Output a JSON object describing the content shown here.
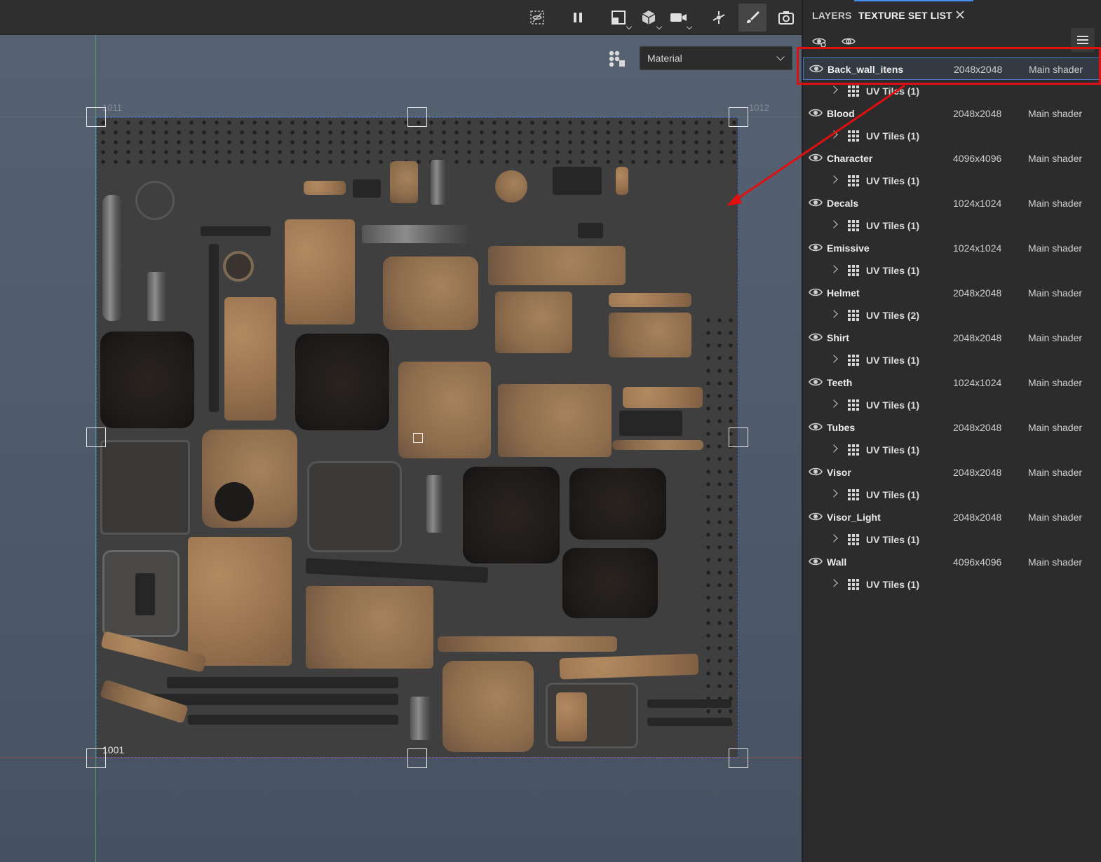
{
  "toolbar": {
    "buttons": [
      {
        "name": "hide-icon"
      },
      {
        "name": "pause-icon"
      },
      {
        "name": "split-view-icon"
      },
      {
        "name": "cube-icon"
      },
      {
        "name": "camera-video-icon"
      },
      {
        "name": "effects-icon"
      },
      {
        "name": "paint-brush-icon"
      },
      {
        "name": "screenshot-camera-icon"
      }
    ]
  },
  "viewport": {
    "display_mode": "Material",
    "udim_labels": {
      "top_left": "1011",
      "top_right": "1012",
      "bottom_left": "1001"
    }
  },
  "panel": {
    "tabs": [
      "LAYERS",
      "TEXTURE SET LIST"
    ],
    "active_tab": "TEXTURE SET LIST",
    "texture_sets": [
      {
        "name": "Back_wall_itens",
        "size": "2048x2048",
        "shader": "Main shader",
        "uv_tiles": "UV Tiles (1)",
        "selected": true
      },
      {
        "name": "Blood",
        "size": "2048x2048",
        "shader": "Main shader",
        "uv_tiles": "UV Tiles (1)"
      },
      {
        "name": "Character",
        "size": "4096x4096",
        "shader": "Main shader",
        "uv_tiles": "UV Tiles (1)"
      },
      {
        "name": "Decals",
        "size": "1024x1024",
        "shader": "Main shader",
        "uv_tiles": "UV Tiles (1)"
      },
      {
        "name": "Emissive",
        "size": "1024x1024",
        "shader": "Main shader",
        "uv_tiles": "UV Tiles (1)"
      },
      {
        "name": "Helmet",
        "size": "2048x2048",
        "shader": "Main shader",
        "uv_tiles": "UV Tiles (2)"
      },
      {
        "name": "Shirt",
        "size": "2048x2048",
        "shader": "Main shader",
        "uv_tiles": "UV Tiles (1)"
      },
      {
        "name": "Teeth",
        "size": "1024x1024",
        "shader": "Main shader",
        "uv_tiles": "UV Tiles (1)"
      },
      {
        "name": "Tubes",
        "size": "2048x2048",
        "shader": "Main shader",
        "uv_tiles": "UV Tiles (1)"
      },
      {
        "name": "Visor",
        "size": "2048x2048",
        "shader": "Main shader",
        "uv_tiles": "UV Tiles (1)"
      },
      {
        "name": "Visor_Light",
        "size": "2048x2048",
        "shader": "Main shader",
        "uv_tiles": "UV Tiles (1)"
      },
      {
        "name": "Wall",
        "size": "4096x4096",
        "shader": "Main shader",
        "uv_tiles": "UV Tiles (1)"
      }
    ]
  },
  "annotation": {
    "color": "#e01010"
  },
  "colors": {
    "accent": "#4a8df0",
    "selection_border": "#4a79c8"
  }
}
